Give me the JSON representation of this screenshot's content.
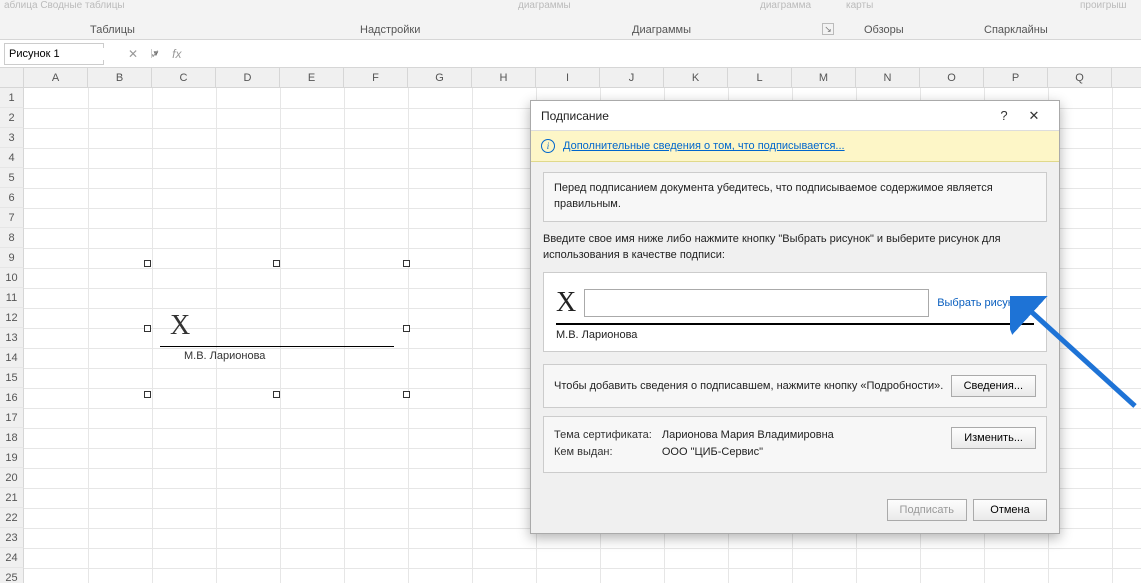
{
  "ribbon": {
    "top_fragments": {
      "tables": "аблица  Сводные таблицы",
      "diag1": "диаграммы",
      "diag2": "диаграмма",
      "map": "карты",
      "win": "проигрыш"
    },
    "groups": {
      "tables": "Таблицы",
      "addins": "Надстройки",
      "charts": "Диаграммы",
      "tours": "Обзоры",
      "spark": "Спарклайны"
    }
  },
  "namebox": "Рисунок 1",
  "columns": [
    "A",
    "B",
    "C",
    "D",
    "E",
    "F",
    "G",
    "H",
    "I",
    "J",
    "K",
    "L",
    "M",
    "N",
    "O",
    "P",
    "Q"
  ],
  "rows": [
    "1",
    "2",
    "3",
    "4",
    "5",
    "6",
    "7",
    "8",
    "9",
    "10",
    "11",
    "12",
    "13",
    "14",
    "15",
    "16",
    "17",
    "18",
    "19",
    "20",
    "21",
    "22",
    "23",
    "24",
    "25"
  ],
  "sheet_sig": {
    "x": "X",
    "name": "М.В. Ларионова"
  },
  "dialog": {
    "title": "Подписание",
    "info_link": "Дополнительные сведения о том, что подписывается...",
    "warn": "Перед подписанием документа убедитесь, что подписываемое содержимое является правильным.",
    "instruction": "Введите свое имя ниже либо нажмите кнопку \"Выбрать рисунок\" и выберите рисунок для использования в качестве подписи:",
    "x": "X",
    "select_pic": "Выбрать рисунок...",
    "signer": "М.В. Ларионова",
    "details_text": "Чтобы добавить сведения о подписавшем, нажмите кнопку «Подробности».",
    "btn_details": "Сведения...",
    "cert": {
      "lbl_subject": "Тема сертификата:",
      "lbl_issuer": "Кем выдан:",
      "subject": "Ларионова Мария Владимировна",
      "issuer": "ООО \"ЦИБ-Сервис\""
    },
    "btn_change": "Изменить...",
    "btn_sign": "Подписать",
    "btn_cancel": "Отмена"
  }
}
